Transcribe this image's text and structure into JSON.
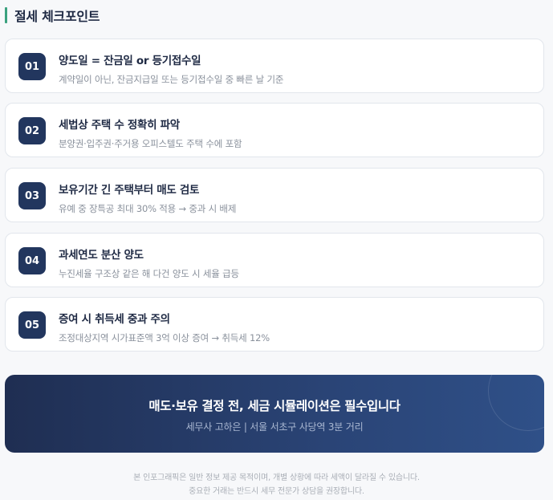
{
  "section": {
    "title": "절세 체크포인트"
  },
  "checkpoints": [
    {
      "number": "01",
      "title": "양도일 = 잔금일 or 등기접수일",
      "description": "계약일이 아닌, 잔금지급일 또는 등기접수일 중 빠른 날 기준"
    },
    {
      "number": "02",
      "title": "세법상 주택 수 정확히 파악",
      "description": "분양권·입주권·주거용 오피스텔도 주택 수에 포함"
    },
    {
      "number": "03",
      "title": "보유기간 긴 주택부터 매도 검토",
      "description": "유예 중 장특공 최대 30% 적용 → 중과 시 배제"
    },
    {
      "number": "04",
      "title": "과세연도 분산 양도",
      "description": "누진세율 구조상 같은 해 다건 양도 시 세율 급등"
    },
    {
      "number": "05",
      "title": "증여 시 취득세 중과 주의",
      "description": "조정대상지역 시가표준액 3억 이상 증여 → 취득세 12%"
    }
  ],
  "banner": {
    "title": "매도·보유 결정 전, 세금 시뮬레이션은 필수입니다",
    "subtitle": "세무사 고하은 | 서울 서초구 사당역 3분 거리"
  },
  "footer": {
    "line1": "본 인포그래픽은 일반 정보 제공 목적이며, 개별 상황에 따라 세액이 달라질 수 있습니다.",
    "line2": "중요한 거래는 반드시 세무 전문가 상담을 권장합니다."
  },
  "colors": {
    "accent": "#3aa17e",
    "badge": "#22365e",
    "banner_start": "#1f2e52",
    "banner_end": "#2f5088"
  }
}
